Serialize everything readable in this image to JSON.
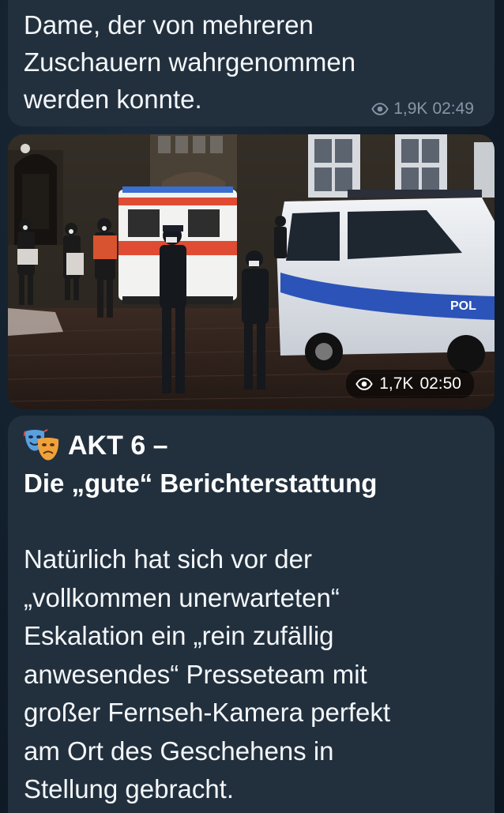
{
  "messages": [
    {
      "text": "Dame, der von mehreren\nZuschauern wahrgenommen\nwerden konnte.",
      "views": "1,9K",
      "time": "02:49"
    },
    {
      "type": "photo",
      "views": "1,7K",
      "time": "02:50"
    },
    {
      "emoji": "performing-arts",
      "title": "AKT 6 –",
      "subtitle": "Die „gute“ Berichterstattung",
      "text": "Natürlich hat sich vor der\n„vollkommen unerwarteten“\nEskalation ein „rein zufällig\nanwesendes“ Presseteam mit\ngroßer Fernseh-Kamera perfekt\nam Ort des Geschehens in\nStellung gebracht."
    }
  ],
  "icons": {
    "views": "eye-icon",
    "emoji": "masks-icon"
  },
  "colors": {
    "bubble": "#22303e",
    "background": "#101c28",
    "meta_text": "#8796a6",
    "text": "#ffffff"
  }
}
